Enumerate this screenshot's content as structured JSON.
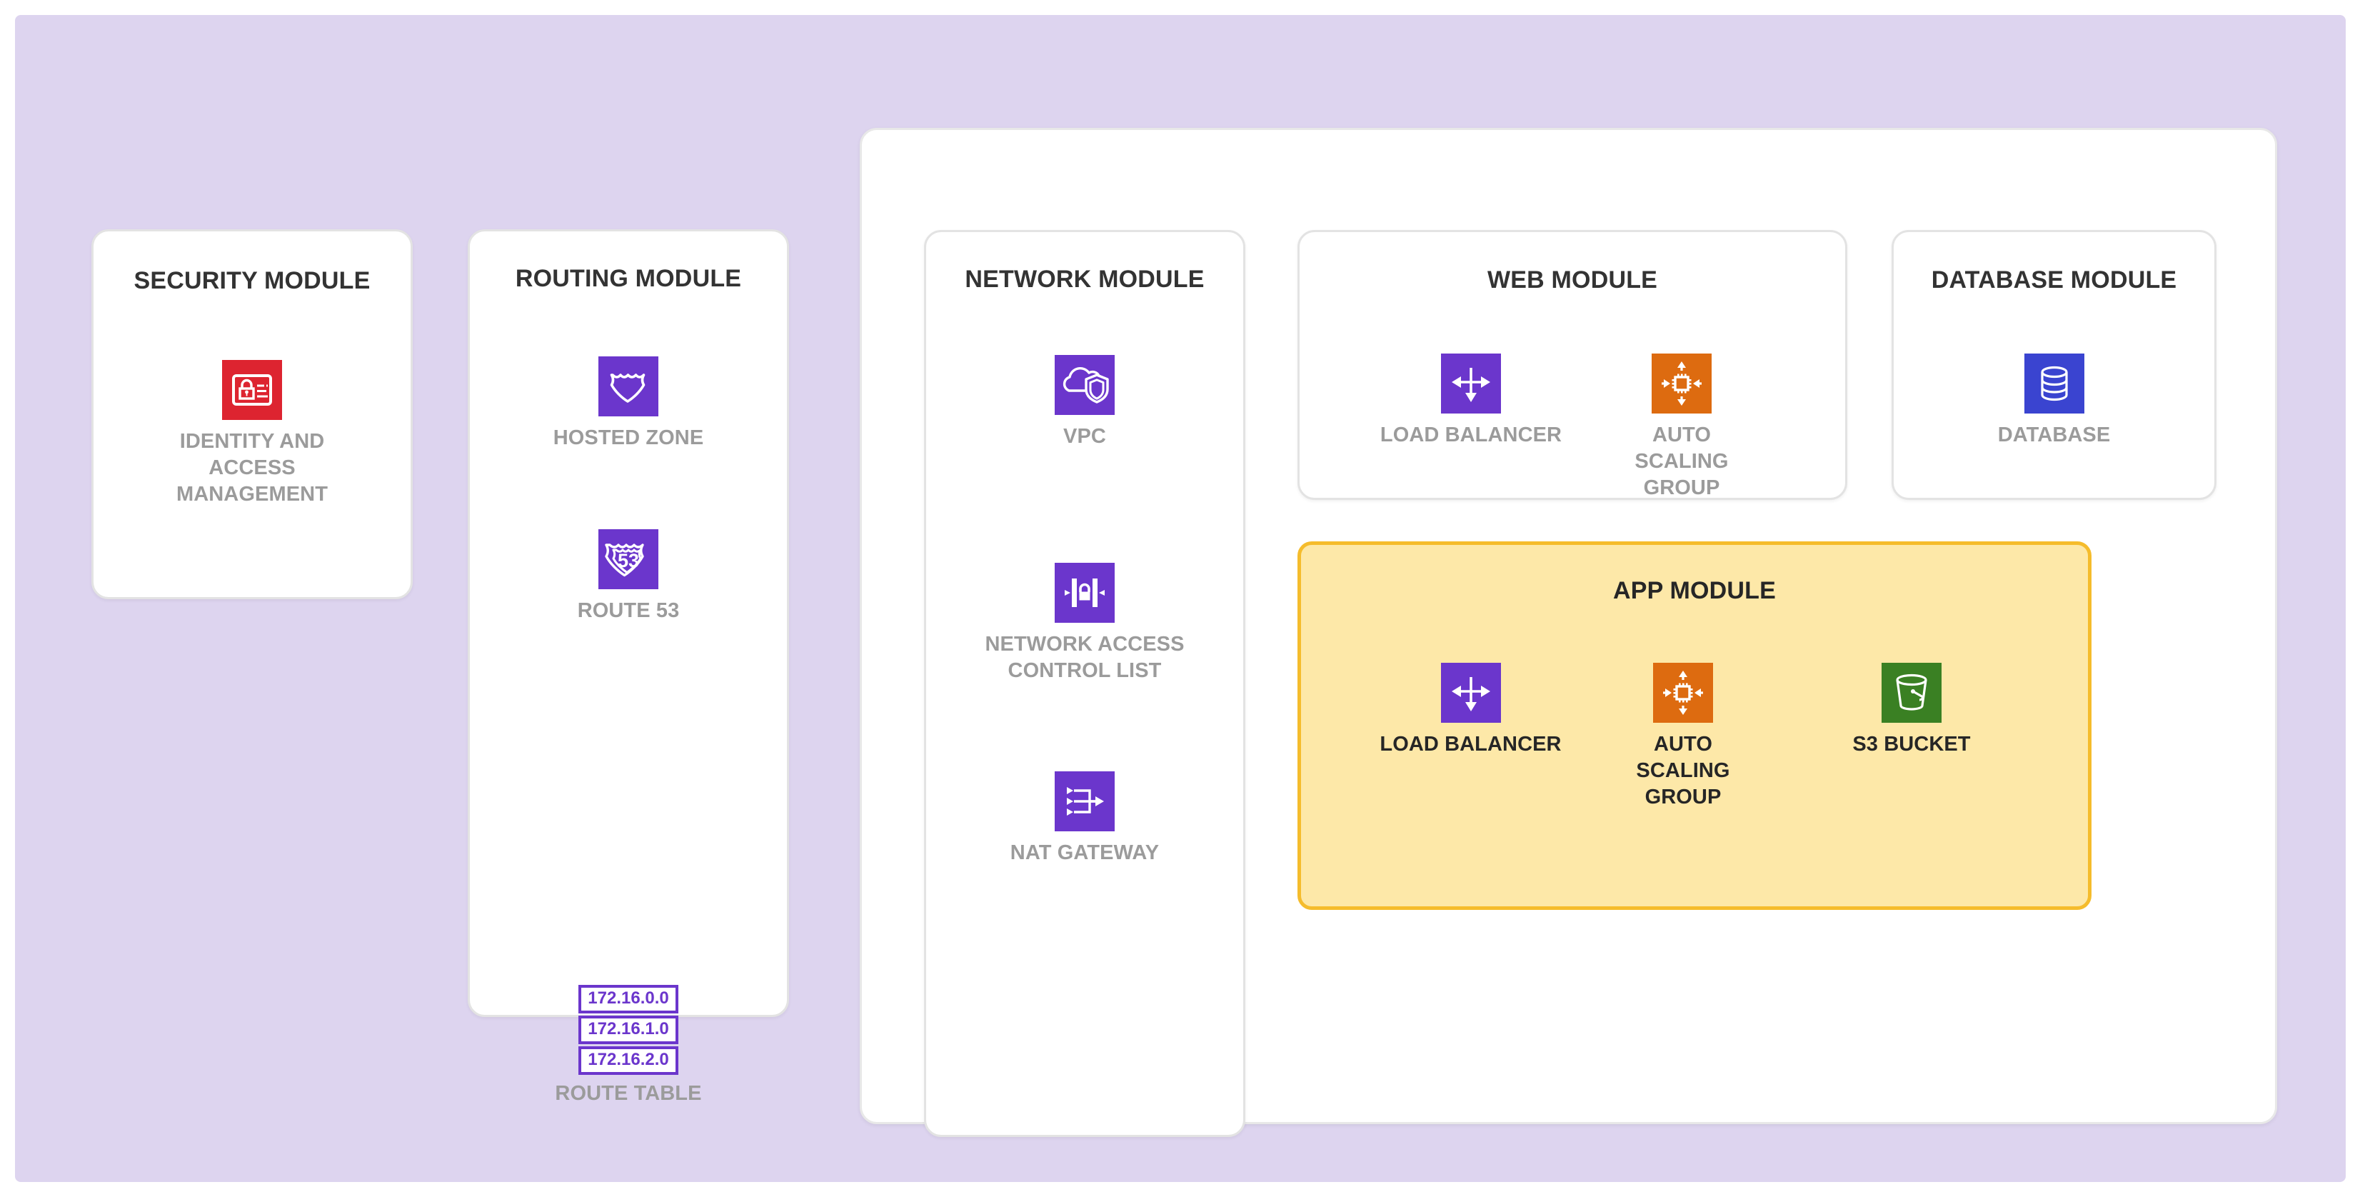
{
  "canvas": {
    "background_color": "#ddd4ef",
    "panel_background_color": "#ffffff"
  },
  "palette": {
    "aws_purple": "#6b36cc",
    "aws_red": "#dd2430",
    "aws_orange": "#dd6b10",
    "aws_green": "#3a8023",
    "aws_blue": "#3a44d0",
    "app_module_fill": "#fde8a8",
    "app_module_border": "#f5bc2c",
    "label_gray": "#9b9b9b",
    "title_dark": "#333333"
  },
  "modules": {
    "security": {
      "title": "SECURITY MODULE",
      "nodes": [
        {
          "label": "IDENTITY AND ACCESS MANAGEMENT",
          "icon": "iam-icon",
          "color": "#dd2430"
        }
      ]
    },
    "routing": {
      "title": "ROUTING MODULE",
      "nodes": [
        {
          "label": "HOSTED ZONE",
          "icon": "hosted-zone-icon",
          "color": "#6b36cc"
        },
        {
          "label": "ROUTE 53",
          "icon": "route53-icon",
          "color": "#6b36cc",
          "badge_text": "53"
        },
        {
          "label": "ROUTE TABLE",
          "icon": "route-table-icon",
          "color": "#6b36cc",
          "rows": [
            "172.16.0.0",
            "172.16.1.0",
            "172.16.2.0"
          ]
        }
      ]
    },
    "network": {
      "title": "NETWORK MODULE",
      "nodes": [
        {
          "label": "VPC",
          "icon": "vpc-icon",
          "color": "#6b36cc"
        },
        {
          "label": "NETWORK ACCESS CONTROL LIST",
          "icon": "nacl-icon",
          "color": "#6b36cc"
        },
        {
          "label": "NAT GATEWAY",
          "icon": "nat-gateway-icon",
          "color": "#6b36cc"
        }
      ]
    },
    "web": {
      "title": "WEB MODULE",
      "nodes": [
        {
          "label": "LOAD BALANCER",
          "icon": "load-balancer-icon",
          "color": "#6b36cc"
        },
        {
          "label": "AUTO SCALING GROUP",
          "icon": "auto-scaling-group-icon",
          "color": "#dd6b10"
        }
      ]
    },
    "database": {
      "title": "DATABASE MODULE",
      "nodes": [
        {
          "label": "DATABASE",
          "icon": "database-icon",
          "color": "#3a44d0"
        }
      ]
    },
    "app": {
      "title": "APP MODULE",
      "nodes": [
        {
          "label": "LOAD BALANCER",
          "icon": "load-balancer-icon",
          "color": "#6b36cc"
        },
        {
          "label": "AUTO SCALING GROUP",
          "icon": "auto-scaling-group-icon",
          "color": "#dd6b10"
        },
        {
          "label": "S3 BUCKET",
          "icon": "s3-bucket-icon",
          "color": "#3a8023"
        }
      ]
    }
  }
}
